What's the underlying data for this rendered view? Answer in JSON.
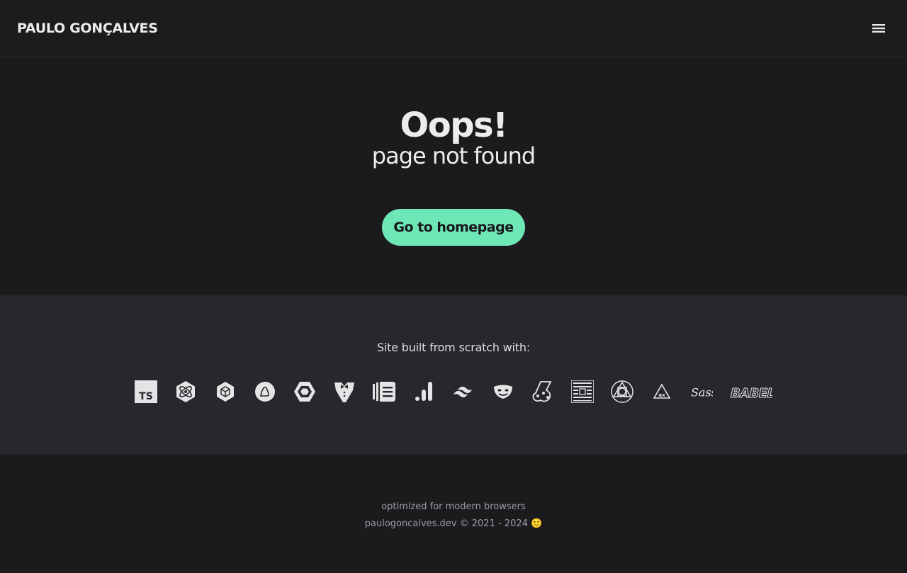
{
  "header": {
    "brand": "PAULO GONÇALVES",
    "menu_icon": "menu-icon"
  },
  "hero": {
    "title": "Oops!",
    "subtitle": "page not found",
    "cta_label": "Go to homepage"
  },
  "tools": {
    "heading": "Site built from scratch with:",
    "icons": [
      "typescript-icon",
      "preact-icon",
      "webpack-icon",
      "lighthouse-icon",
      "eslint-icon",
      "gatsby-tuxedo-icon",
      "stencil-icon",
      "analytics-icon",
      "tailwind-icon",
      "playwright-icon",
      "jest-icon",
      "puppeteer-icon",
      "pwa-icon",
      "axe-icon",
      "sass-icon",
      "babel-icon"
    ]
  },
  "footer": {
    "line1": "optimized for modern browsers",
    "line2": "paulogoncalves.dev © 2021 - 2024 🙂"
  },
  "colors": {
    "background": "#1b1b1e",
    "band": "#28282c",
    "accent": "#6ee7b7",
    "text": "#ececee"
  }
}
